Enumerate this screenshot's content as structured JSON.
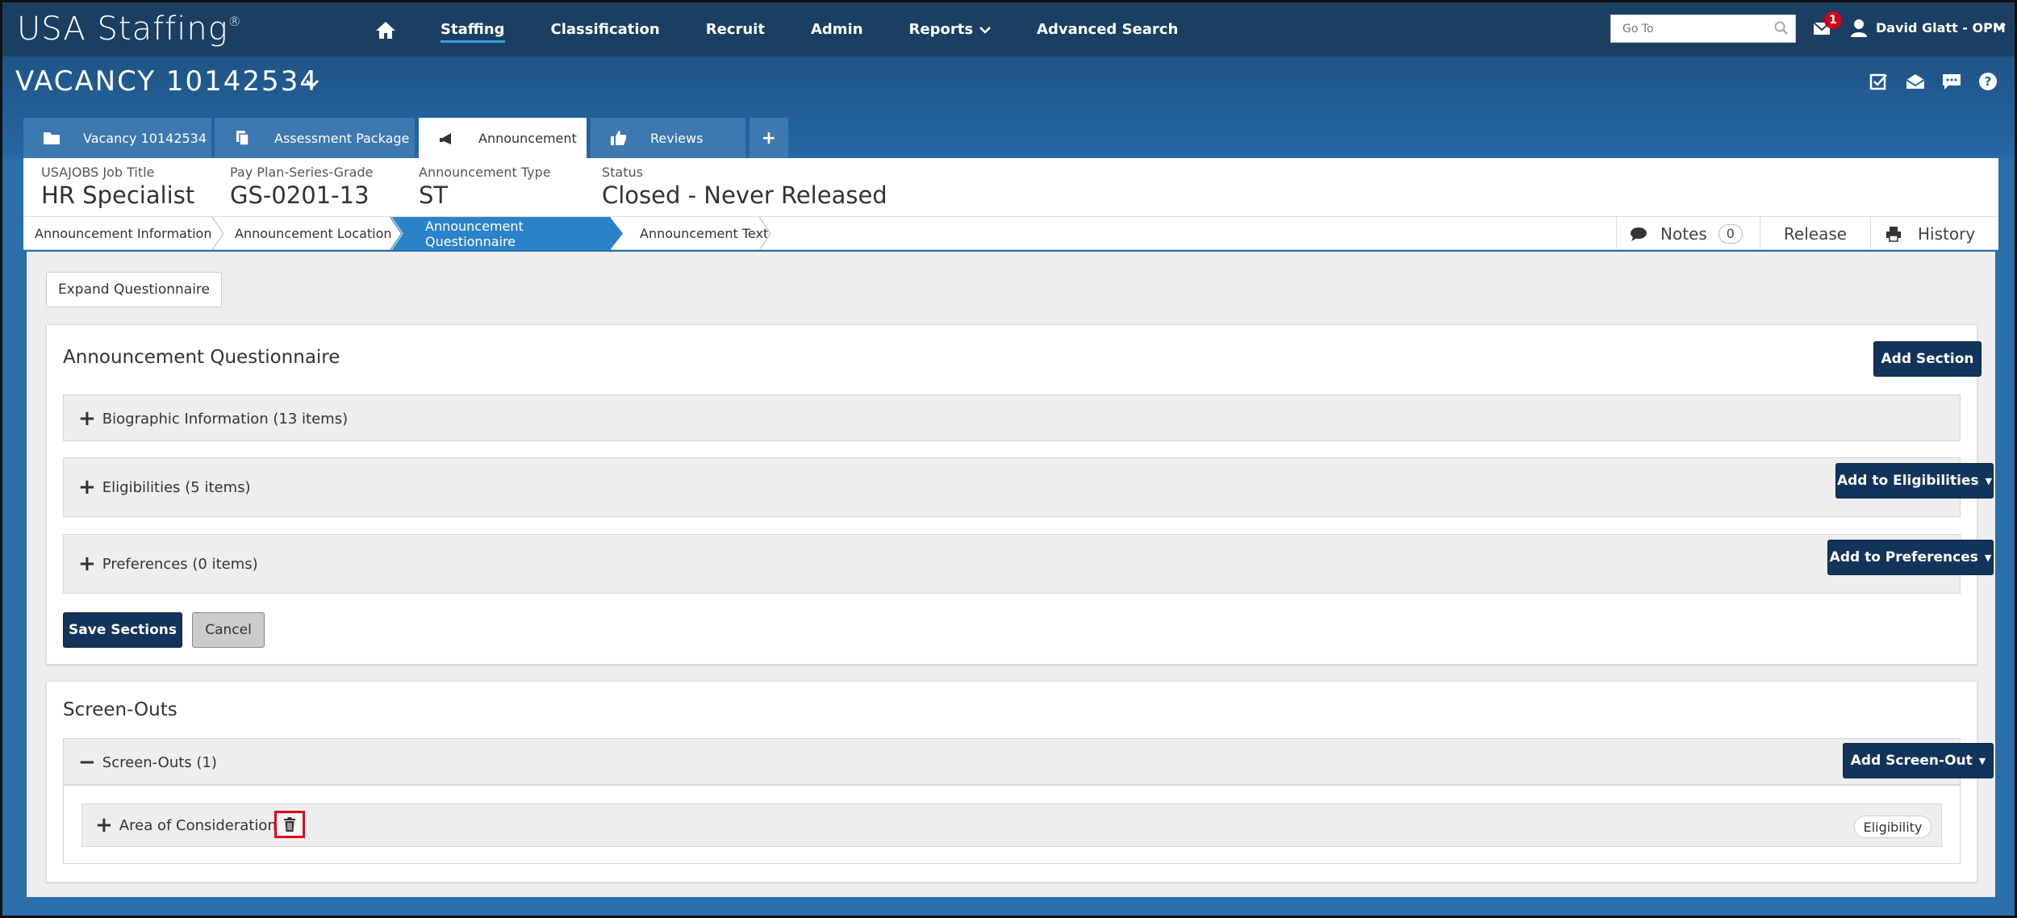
{
  "app": {
    "logo": "USA Staffing",
    "logo_mark": "®"
  },
  "nav": {
    "items": [
      {
        "label": "Staffing",
        "active": true
      },
      {
        "label": "Classification",
        "active": false
      },
      {
        "label": "Recruit",
        "active": false
      },
      {
        "label": "Admin",
        "active": false
      },
      {
        "label": "Reports",
        "active": false,
        "has_dropdown": true
      },
      {
        "label": "Advanced Search",
        "active": false
      }
    ],
    "goto_placeholder": "Go To",
    "notification_count": "1",
    "user_name": "David Glatt - OPM"
  },
  "vacancy": {
    "title": "VACANCY 10142534"
  },
  "tabs": [
    {
      "label": "Vacancy 10142534",
      "icon": "folder-icon"
    },
    {
      "label": "Assessment Package",
      "icon": "copy-icon"
    },
    {
      "label": "Announcement",
      "icon": "megaphone-icon",
      "active": true
    },
    {
      "label": "Reviews",
      "icon": "thumbs-up-icon"
    }
  ],
  "tab_add_label": "+",
  "info": {
    "job_title_label": "USAJOBS Job Title",
    "job_title_value": "HR Specialist",
    "ppsg_label": "Pay Plan-Series-Grade",
    "ppsg_value": "GS-0201-13",
    "type_label": "Announcement Type",
    "type_value": "ST",
    "status_label": "Status",
    "status_value": "Closed - Never Released"
  },
  "steps": [
    {
      "label": "Announcement Information"
    },
    {
      "label": "Announcement Location"
    },
    {
      "label": "Announcement Questionnaire",
      "active": true
    },
    {
      "label": "Announcement Text"
    }
  ],
  "tools": {
    "notes_label": "Notes",
    "notes_count": "0",
    "release_label": "Release",
    "history_label": "History"
  },
  "questionnaire": {
    "expand_label": "Expand Questionnaire",
    "title": "Announcement Questionnaire",
    "add_section_label": "Add Section",
    "sections": [
      {
        "label": "Biographic Information (13 items)"
      },
      {
        "label": "Eligibilities (5 items)",
        "button": "Add to Eligibilities"
      },
      {
        "label": "Preferences (0 items)",
        "button": "Add to Preferences"
      }
    ],
    "save_label": "Save Sections",
    "cancel_label": "Cancel"
  },
  "screenouts": {
    "title": "Screen-Outs",
    "group_label": "Screen-Outs (1)",
    "add_label": "Add Screen-Out",
    "item_label": "Area of Consideration",
    "item_tag": "Eligibility"
  },
  "colors": {
    "nav_bg": "#1b3f63",
    "header_blue": "#2467a4",
    "active_step": "#2a83c8",
    "dark_button": "#13345a",
    "highlight_red": "#e0001a"
  }
}
